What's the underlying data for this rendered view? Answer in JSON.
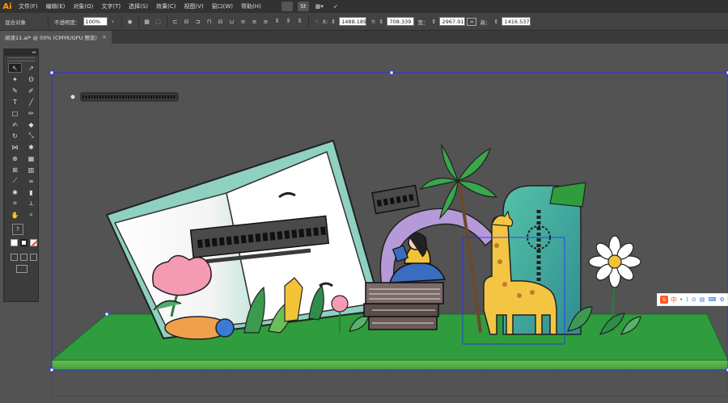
{
  "app": {
    "logo": "Ai"
  },
  "menu": [
    "文件(F)",
    "编辑(E)",
    "对象(O)",
    "文字(T)",
    "选择(S)",
    "效果(C)",
    "视图(V)",
    "窗口(W)",
    "帮助(H)"
  ],
  "menubar_icons": [
    "bridge-icon",
    "stock-icon",
    "arrange-documents-icon",
    "send-icon"
  ],
  "control": {
    "selection": "混合对象",
    "opacity_label": "不透明度：",
    "opacity_value": "100%",
    "x_label": "X:",
    "x_value": "1488.189",
    "y_label": "Y:",
    "y_value": "708.339",
    "w_label": "宽：",
    "w_value": "2967.91",
    "h_label": "高：",
    "h_value": "1416.537"
  },
  "document": {
    "tab_title": "阅读11.ai* @ 50% (CMYK/GPU 预览)",
    "close": "×"
  },
  "toolbox": {
    "collapse": "◂◂",
    "tools": [
      {
        "name": "selection-tool",
        "glyph": "↖",
        "active": true
      },
      {
        "name": "direct-selection-tool",
        "glyph": "↗",
        "active": false
      },
      {
        "name": "magic-wand-tool",
        "glyph": "✦",
        "active": false
      },
      {
        "name": "lasso-tool",
        "glyph": "ʘ",
        "active": false
      },
      {
        "name": "pen-tool",
        "glyph": "✎",
        "active": false
      },
      {
        "name": "curvature-tool",
        "glyph": "✐",
        "active": false
      },
      {
        "name": "type-tool",
        "glyph": "T",
        "active": false
      },
      {
        "name": "line-tool",
        "glyph": "╱",
        "active": false
      },
      {
        "name": "rectangle-tool",
        "glyph": "□",
        "active": false
      },
      {
        "name": "paintbrush-tool",
        "glyph": "✏",
        "active": false
      },
      {
        "name": "shaper-tool",
        "glyph": "✍",
        "active": false
      },
      {
        "name": "eraser-tool",
        "glyph": "◆",
        "active": false
      },
      {
        "name": "rotate-tool",
        "glyph": "↻",
        "active": false
      },
      {
        "name": "scale-tool",
        "glyph": "⤡",
        "active": false
      },
      {
        "name": "width-tool",
        "glyph": "⋈",
        "active": false
      },
      {
        "name": "puppet-warp-tool",
        "glyph": "✱",
        "active": false
      },
      {
        "name": "shape-builder-tool",
        "glyph": "⊕",
        "active": false
      },
      {
        "name": "perspective-grid-tool",
        "glyph": "▦",
        "active": false
      },
      {
        "name": "mesh-tool",
        "glyph": "⊞",
        "active": false
      },
      {
        "name": "gradient-tool",
        "glyph": "▥",
        "active": false
      },
      {
        "name": "eyedropper-tool",
        "glyph": "⟋",
        "active": false
      },
      {
        "name": "blend-tool",
        "glyph": "∞",
        "active": false
      },
      {
        "name": "symbol-sprayer-tool",
        "glyph": "✺",
        "active": false
      },
      {
        "name": "column-graph-tool",
        "glyph": "▮",
        "active": false
      },
      {
        "name": "artboard-tool",
        "glyph": "⌗",
        "active": false
      },
      {
        "name": "slice-tool",
        "glyph": "⟂",
        "active": false
      },
      {
        "name": "hand-tool",
        "glyph": "✋",
        "active": false
      },
      {
        "name": "zoom-tool",
        "glyph": "⌕",
        "active": false
      }
    ],
    "help": "?"
  },
  "ime": {
    "mode": "中",
    "items": [
      "•",
      ")",
      "⊙",
      "▤",
      "⌨",
      "⚙"
    ]
  },
  "colors": {
    "canvas": "#535353",
    "floor_top": "#2e9a3c",
    "floor_front": "#5bb84a",
    "book_border": "#7cc9b6",
    "book_page": "#f7f7f7",
    "arch": "#b59ad8",
    "door": "#3aa89a",
    "giraffe": "#f4c542",
    "flower_pink": "#f49ab3",
    "selection": "#2a2aff",
    "accent": "#ff9a00"
  }
}
